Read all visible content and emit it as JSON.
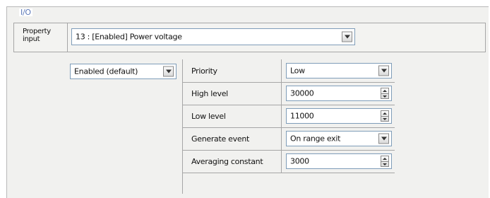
{
  "group_title": "I/O",
  "property_input": {
    "label": "Property\ninput",
    "selected": "13 : [Enabled] Power voltage"
  },
  "state_select": {
    "selected": "Enabled (default)"
  },
  "properties": [
    {
      "label": "Priority",
      "value": "Low",
      "control": "dropdown"
    },
    {
      "label": "High level",
      "value": "30000",
      "control": "spinner"
    },
    {
      "label": "Low level",
      "value": "11000",
      "control": "spinner"
    },
    {
      "label": "Generate event",
      "value": "On range exit",
      "control": "dropdown"
    },
    {
      "label": "Averaging constant",
      "value": "3000",
      "control": "spinner"
    }
  ]
}
